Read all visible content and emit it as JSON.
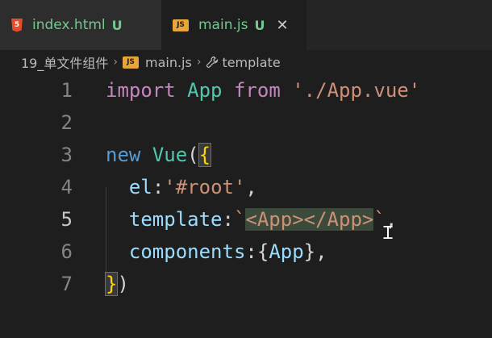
{
  "tabs": [
    {
      "icon": "html5-icon",
      "icon_text": "5",
      "name": "index.html",
      "status": "U",
      "active": false
    },
    {
      "icon": "js-icon",
      "icon_text": "JS",
      "name": "main.js",
      "status": "U",
      "active": true,
      "close": "✕"
    }
  ],
  "breadcrumb": {
    "folder": "19_单文件组件",
    "file_icon_text": "JS",
    "file": "main.js",
    "symbol": "template",
    "separator": "›"
  },
  "editor": {
    "line_numbers": [
      "1",
      "2",
      "3",
      "4",
      "5",
      "6",
      "7"
    ],
    "current_line": 5,
    "lines": {
      "l1": {
        "import": "import",
        "app": "App",
        "from": "from",
        "path": "'./App.vue'"
      },
      "l3": {
        "new": "new",
        "vue": "Vue",
        "paren": "(",
        "brace": "{"
      },
      "l4": {
        "key": "el",
        "colon": ":",
        "value": "'#root'",
        "comma": ","
      },
      "l5": {
        "key": "template",
        "colon": ":",
        "tick_open": "`",
        "value": "<App></App>",
        "tick_close": "`",
        "comma": ","
      },
      "l6": {
        "key": "components",
        "colon": ":",
        "open": "{",
        "value": "App",
        "close": "}",
        "comma": ","
      },
      "l7": {
        "brace": "}",
        "paren": ")"
      }
    }
  },
  "colors": {
    "background": "#1e1e1e",
    "keyword": "#c586c0",
    "class": "#4ec9b0",
    "string": "#ce9178",
    "property": "#9cdcfe",
    "modified": "#73c991"
  }
}
